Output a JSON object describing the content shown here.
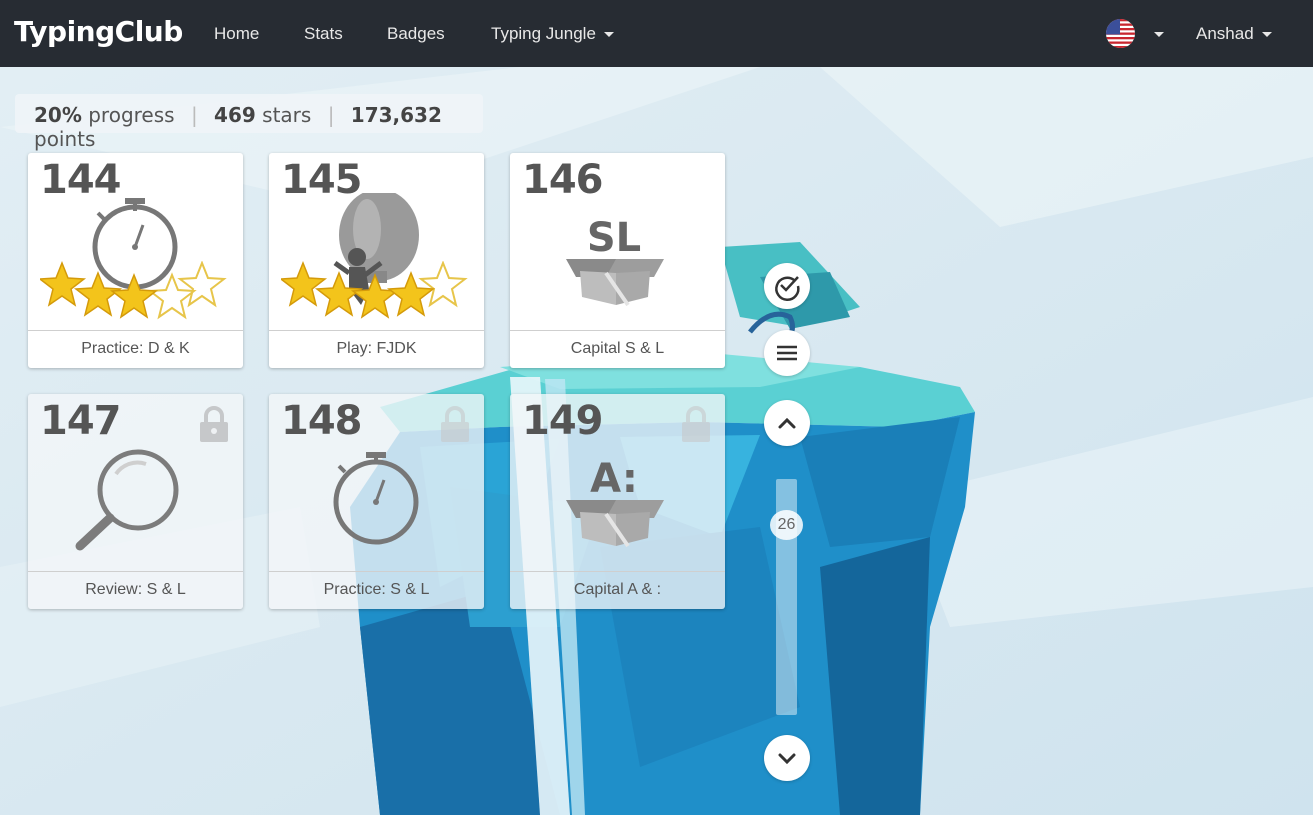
{
  "navbar": {
    "logo": "TypingClub",
    "links": {
      "home": "Home",
      "stats": "Stats",
      "badges": "Badges",
      "course": "Typing Jungle"
    },
    "user": "Anshad"
  },
  "progress": {
    "percent": "20%",
    "percent_label": "progress",
    "stars": "469",
    "stars_label": "stars",
    "points": "173,632",
    "points_label": "points"
  },
  "lessons": [
    {
      "number": "144",
      "title": "Practice: D & K",
      "icon": "stopwatch-icon",
      "stars": 3,
      "locked": false
    },
    {
      "number": "145",
      "title": "Play: FJDK",
      "icon": "balloon-game-icon",
      "stars": 4,
      "locked": false
    },
    {
      "number": "146",
      "title": "Capital S & L",
      "icon": "letter-box-icon",
      "box_text": "SL",
      "locked": false
    },
    {
      "number": "147",
      "title": "Review: S & L",
      "icon": "magnifier-icon",
      "locked": true
    },
    {
      "number": "148",
      "title": "Practice: S & L",
      "icon": "stopwatch-icon",
      "locked": true
    },
    {
      "number": "149",
      "title": "Capital A & :",
      "icon": "letter-box-icon",
      "box_text": "A:",
      "locked": true
    }
  ],
  "sidebar": {
    "scroll_position": "26"
  },
  "colors": {
    "navbar": "#272c33",
    "star": "#f3c41b",
    "water": "#1e8ecb",
    "island_top": "#5fd3d6"
  }
}
